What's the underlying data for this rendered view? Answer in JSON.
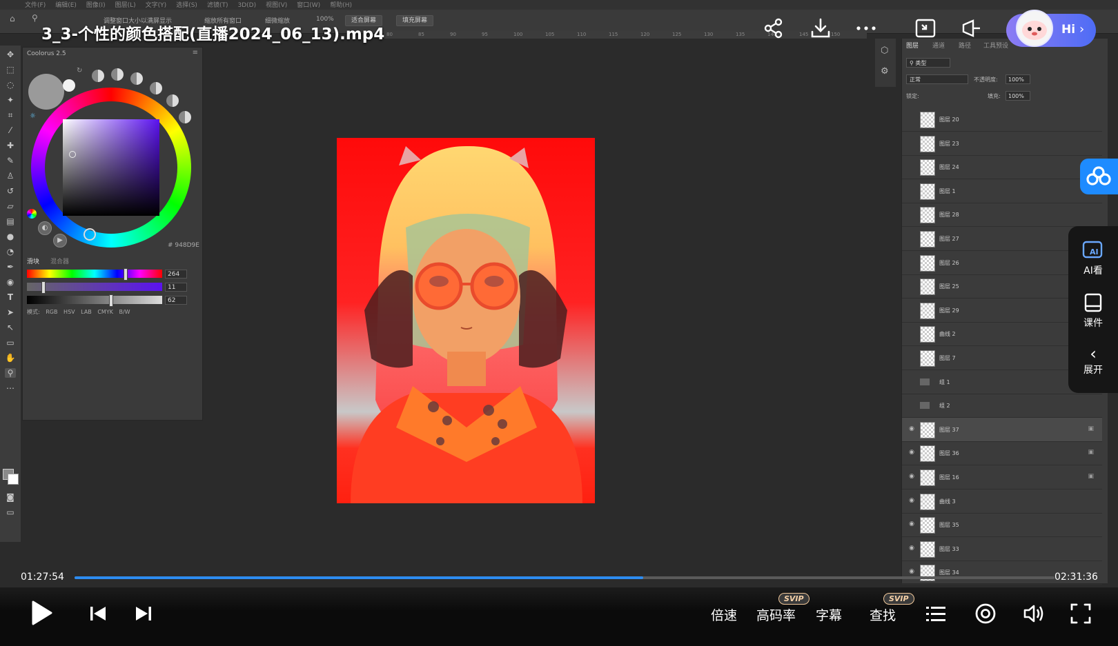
{
  "video": {
    "title": "3_3-个性的颜色搭配(直播2024_06_13).mp4",
    "current_time": "01:27:54",
    "total_time": "02:31:36",
    "progress_fraction": 0.58
  },
  "ps_menu": [
    "文件(F)",
    "编辑(E)",
    "图像(I)",
    "图层(L)",
    "文字(Y)",
    "选择(S)",
    "滤镜(T)",
    "3D(D)",
    "视图(V)",
    "窗口(W)",
    "帮助(H)"
  ],
  "ps_options": {
    "resize_windows": "调整窗口大小以满屏显示",
    "zoom_all": "缩放所有窗口",
    "scrubby_zoom": "细微缩放",
    "zoom_pct": "100%",
    "fit_screen": "适合屏幕",
    "fill_screen": "填充屏幕"
  },
  "ruler_ticks": [
    "80",
    "85",
    "90",
    "95",
    "100",
    "105",
    "110",
    "115",
    "120",
    "125",
    "130",
    "135",
    "140",
    "145",
    "150"
  ],
  "coolorus": {
    "title": "Coolorus 2.5",
    "hex": "# 948D9E",
    "tab_sliders": "滑块",
    "tab_mixer": "混合器",
    "hue": "264",
    "sat": "11",
    "bri": "62",
    "hue_fraction": 0.73,
    "sat_fraction": 0.11,
    "bri_fraction": 0.62,
    "mode_label": "模式:",
    "modes": [
      "RGB",
      "HSV",
      "LAB",
      "CMYK",
      "B/W"
    ]
  },
  "layers": {
    "tabs": [
      "图层",
      "通道",
      "路径",
      "工具预设"
    ],
    "kind_label": "类型",
    "blend_mode": "正常",
    "opacity_label": "不透明度:",
    "opacity": "100%",
    "lock_label": "锁定:",
    "fill_label": "填充:",
    "fill": "100%",
    "rows": [
      {
        "name": "图层 20",
        "visible": false,
        "locked": false
      },
      {
        "name": "图层 23",
        "visible": false,
        "locked": false
      },
      {
        "name": "图层 24",
        "visible": false,
        "locked": false
      },
      {
        "name": "图层 1",
        "visible": false,
        "locked": false
      },
      {
        "name": "图层 28",
        "visible": false,
        "locked": false
      },
      {
        "name": "图层 27",
        "visible": false,
        "locked": false
      },
      {
        "name": "图层 26",
        "visible": false,
        "locked": false
      },
      {
        "name": "图层 25",
        "visible": false,
        "locked": false
      },
      {
        "name": "图层 29",
        "visible": false,
        "locked": false
      },
      {
        "name": "曲线 2",
        "visible": false,
        "locked": false
      },
      {
        "name": "图层 7",
        "visible": false,
        "locked": false
      },
      {
        "name": "组 1",
        "visible": false,
        "locked": false
      },
      {
        "name": "组 2",
        "visible": false,
        "locked": false
      },
      {
        "name": "图层 37",
        "visible": true,
        "locked": true
      },
      {
        "name": "图层 36",
        "visible": true,
        "locked": true
      },
      {
        "name": "图层 16",
        "visible": true,
        "locked": true
      },
      {
        "name": "曲线 3",
        "visible": true,
        "locked": false
      },
      {
        "name": "图层 35",
        "visible": true,
        "locked": false
      },
      {
        "name": "图层 33",
        "visible": true,
        "locked": false
      },
      {
        "name": "图层 34",
        "visible": true,
        "locked": false
      }
    ]
  },
  "hi_button": {
    "label": "Hi"
  },
  "side_panel": {
    "ai_label": "AI看",
    "courseware_label": "课件",
    "expand_label": "展开"
  },
  "controls": {
    "speed_label": "倍速",
    "bitrate_label": "高码率",
    "subtitle_label": "字幕",
    "search_label": "查找",
    "svip_badge": "SVIP"
  }
}
